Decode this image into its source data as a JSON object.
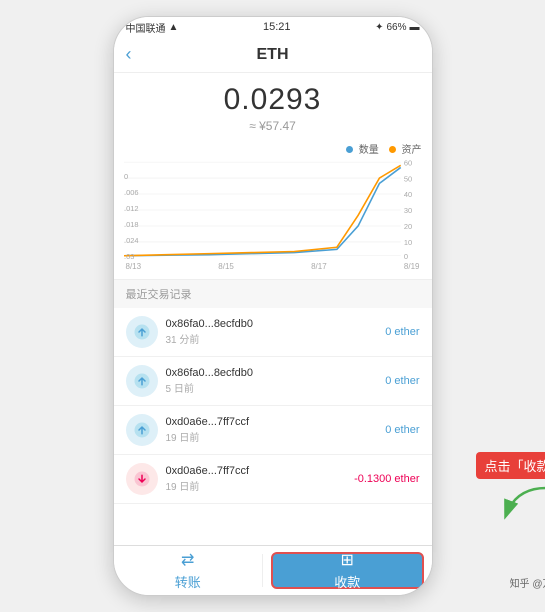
{
  "statusBar": {
    "carrier": "中国联通",
    "wifi": "WiFi",
    "time": "15:21",
    "bluetooth": "BT",
    "battery": "66%"
  },
  "header": {
    "back": "‹",
    "title": "ETH"
  },
  "balance": {
    "value": "0.0293",
    "cny": "≈ ¥57.47"
  },
  "chart": {
    "legend": {
      "quantity_label": "数量",
      "asset_label": "资产"
    },
    "yLabels": [
      "60",
      "50",
      "40",
      "30",
      "20",
      "10",
      "0"
    ],
    "yLabelsLeft": [
      ".03",
      ".024",
      ".018",
      ".012",
      ".006",
      "0"
    ],
    "xLabels": [
      "8/13",
      "8/15",
      "8/17",
      "8/19"
    ]
  },
  "section": {
    "title": "最近交易记录"
  },
  "transactions": [
    {
      "address": "0x86fa0...8ecfdb0",
      "time": "31 分前",
      "amount": "0 ether",
      "type": "receive"
    },
    {
      "address": "0x86fa0...8ecfdb0",
      "time": "5 日前",
      "amount": "0 ether",
      "type": "receive"
    },
    {
      "address": "0xd0a6e...7ff7ccf",
      "time": "19 日前",
      "amount": "0 ether",
      "type": "receive"
    },
    {
      "address": "0xd0a6e...7ff7ccf",
      "time": "19 日前",
      "amount": "-0.1300 ether",
      "type": "send"
    }
  ],
  "bottomBar": {
    "transfer_label": "转账",
    "receive_label": "收款"
  },
  "annotation": {
    "text": "点击「收款」"
  },
  "watermark": "知乎 @万岁"
}
